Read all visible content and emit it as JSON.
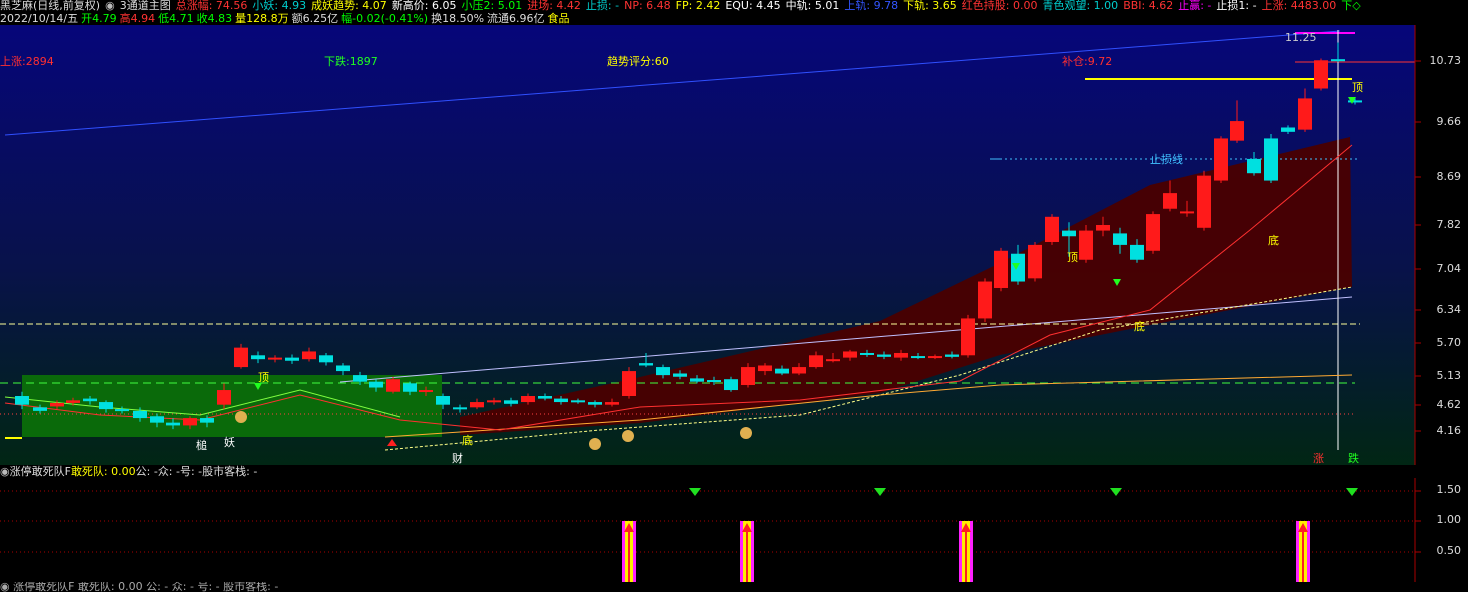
{
  "header": {
    "items": [
      {
        "text": "黑芝麻(日线,前复权)",
        "color": "#dddddd"
      },
      {
        "text": "◉",
        "color": "#bbbbbb"
      },
      {
        "text": "3通道主图",
        "color": "#dddddd"
      },
      {
        "text": "总涨幅: 74.56",
        "color": "#ff3333"
      },
      {
        "text": "小妖: 4.93",
        "color": "#00cccc"
      },
      {
        "text": "成妖趋势: 4.07",
        "color": "#ffff00"
      },
      {
        "text": "新高价: 6.05",
        "color": "#ffffff"
      },
      {
        "text": "小压2: 5.01",
        "color": "#00ff00"
      },
      {
        "text": "进场: 4.42",
        "color": "#ff3333"
      },
      {
        "text": "止损: -",
        "color": "#00cccc"
      },
      {
        "text": "NP: 6.48",
        "color": "#ff3333"
      },
      {
        "text": "FP: 2.42",
        "color": "#ffff00"
      },
      {
        "text": "EQU: 4.45",
        "color": "#ffffff"
      },
      {
        "text": "中轨: 5.01",
        "color": "#ffffff"
      },
      {
        "text": "上轨: 9.78",
        "color": "#3355ff"
      },
      {
        "text": "下轨: 3.65",
        "color": "#ffff00"
      },
      {
        "text": "红色持股: 0.00",
        "color": "#ff3333"
      },
      {
        "text": "青色观望: 1.00",
        "color": "#00cccc"
      },
      {
        "text": "BBI: 4.62",
        "color": "#ff3333"
      },
      {
        "text": "止赢: -",
        "color": "#ff00ff"
      },
      {
        "text": "止损1: -",
        "color": "#ffffff"
      },
      {
        "text": "上涨: 4483.00",
        "color": "#ff3333"
      },
      {
        "text": "下◇",
        "color": "#00ff00"
      }
    ],
    "line2": [
      {
        "text": "2022/10/14/五",
        "color": "#dddddd"
      },
      {
        "text": "开4.79",
        "color": "#00ff00"
      },
      {
        "text": "高4.94",
        "color": "#ff3333"
      },
      {
        "text": "低4.71",
        "color": "#00ff00"
      },
      {
        "text": "收4.83",
        "color": "#00ff00"
      },
      {
        "text": "量128.8万",
        "color": "#ffff00"
      },
      {
        "text": "额6.25亿",
        "color": "#dddddd"
      },
      {
        "text": "幅-0.02(-0.41%)",
        "color": "#00ff00"
      },
      {
        "text": "换18.50%",
        "color": "#dddddd"
      },
      {
        "text": "流通6.96亿",
        "color": "#dddddd"
      },
      {
        "text": "食品",
        "color": "#ffff00"
      }
    ]
  },
  "chart_labels": {
    "up_count": "上涨:2894",
    "down_count": "下跌:1897",
    "trend_score": "趋势评分:60",
    "add_position": "补仓:9.72",
    "stop_line": "止损线",
    "top_value": "11.25",
    "top": "顶",
    "bottom": "底",
    "cai": "财",
    "zhang": "涨",
    "die": "跌",
    "yao": "妖",
    "chui": "槌"
  },
  "y_axis": [
    "10.73",
    "9.66",
    "8.69",
    "7.82",
    "7.04",
    "6.34",
    "5.70",
    "5.13",
    "4.62",
    "4.16"
  ],
  "sub_header": {
    "items": [
      {
        "text": "◉",
        "color": "#bbbbbb"
      },
      {
        "text": "涨停敢死队F",
        "color": "#dddddd"
      },
      {
        "text": "敢死队: 0.00",
        "color": "#ffff00"
      },
      {
        "text": "公: -",
        "color": "#dddddd"
      },
      {
        "text": "众: -",
        "color": "#dddddd"
      },
      {
        "text": "号: -",
        "color": "#dddddd"
      },
      {
        "text": "股市客栈: -",
        "color": "#dddddd"
      }
    ]
  },
  "sub_axis": [
    "1.50",
    "1.00",
    "0.50"
  ],
  "bottom_header": "◉ 涨停敢死队F 敢死队: 0.00  公: -  众: -  号: -  股市客栈: -",
  "colors": {
    "up": "#ff2020",
    "down": "#00e0e0",
    "bg_top": "#050a70",
    "bg_bottom": "#002010"
  }
}
